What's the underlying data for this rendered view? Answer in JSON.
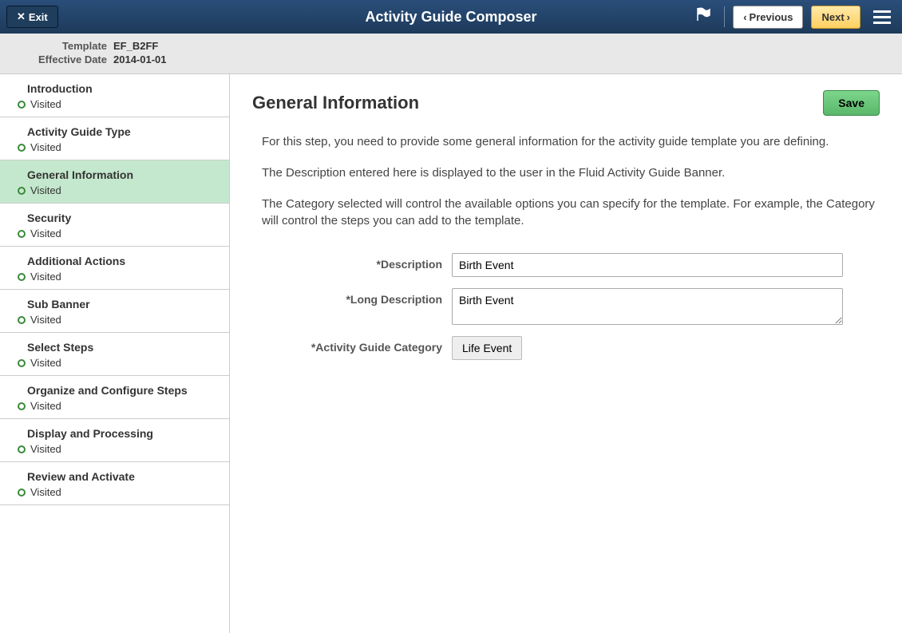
{
  "header": {
    "exit_label": "Exit",
    "title": "Activity Guide Composer",
    "previous_label": "Previous",
    "next_label": "Next"
  },
  "info": {
    "template_label": "Template",
    "template_value": "EF_B2FF",
    "effdate_label": "Effective Date",
    "effdate_value": "2014-01-01"
  },
  "sidebar": {
    "items": [
      {
        "title": "Introduction",
        "status": "Visited"
      },
      {
        "title": "Activity Guide Type",
        "status": "Visited"
      },
      {
        "title": "General Information",
        "status": "Visited"
      },
      {
        "title": "Security",
        "status": "Visited"
      },
      {
        "title": "Additional Actions",
        "status": "Visited"
      },
      {
        "title": "Sub Banner",
        "status": "Visited"
      },
      {
        "title": "Select Steps",
        "status": "Visited"
      },
      {
        "title": "Organize and Configure Steps",
        "status": "Visited"
      },
      {
        "title": "Display and Processing",
        "status": "Visited"
      },
      {
        "title": "Review and Activate",
        "status": "Visited"
      }
    ],
    "active_index": 2
  },
  "content": {
    "page_title": "General Information",
    "save_label": "Save",
    "help_1": "For this step, you need to provide some general information for the activity guide template you are defining.",
    "help_2": "The Description entered here is displayed to the user in the Fluid Activity Guide Banner.",
    "help_3": "The Category selected will control the available options you can specify for the template. For example, the Category will control the steps you can add to the template.",
    "form": {
      "description_label": "*Description",
      "description_value": "Birth Event",
      "longdesc_label": "*Long Description",
      "longdesc_value": "Birth Event",
      "category_label": "*Activity Guide Category",
      "category_value": "Life Event"
    }
  }
}
